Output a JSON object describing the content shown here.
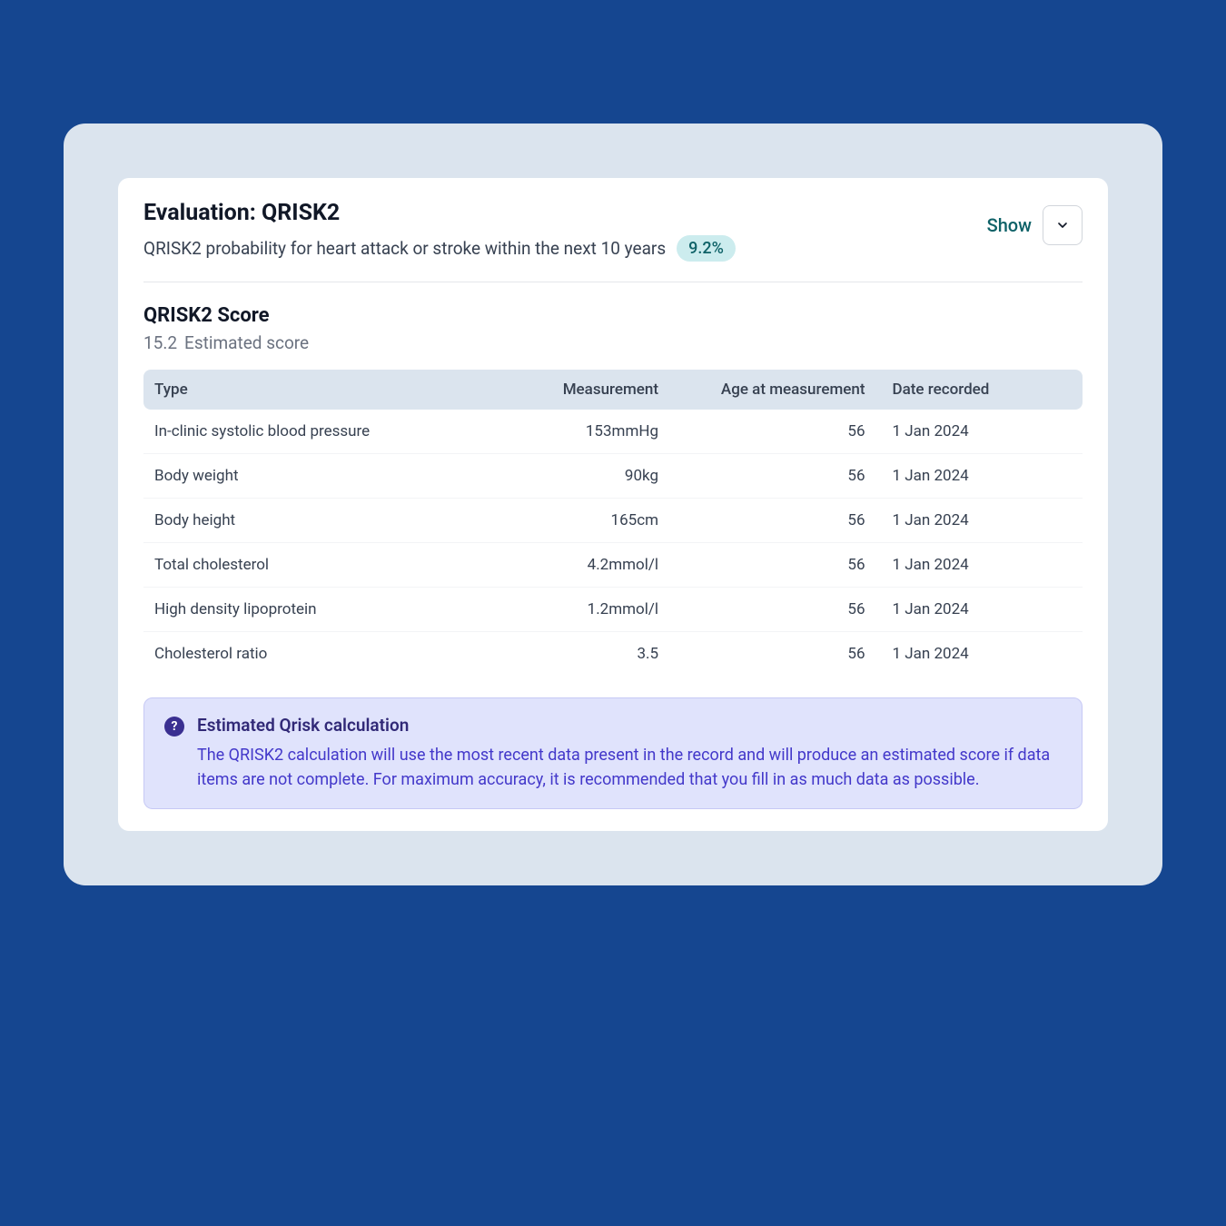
{
  "header": {
    "title": "Evaluation: QRISK2",
    "subtitle": "QRISK2 probability for heart attack or stroke within the next 10 years",
    "probability": "9.2%",
    "show_label": "Show"
  },
  "score": {
    "title": "QRISK2 Score",
    "value": "15.2",
    "label": "Estimated score"
  },
  "table": {
    "headers": {
      "type": "Type",
      "measurement": "Measurement",
      "age": "Age at measurement",
      "date": "Date recorded"
    },
    "rows": [
      {
        "type": "In-clinic systolic blood pressure",
        "measurement": "153mmHg",
        "age": "56",
        "date": "1 Jan 2024"
      },
      {
        "type": "Body weight",
        "measurement": "90kg",
        "age": "56",
        "date": "1 Jan 2024"
      },
      {
        "type": "Body height",
        "measurement": "165cm",
        "age": "56",
        "date": "1 Jan 2024"
      },
      {
        "type": "Total cholesterol",
        "measurement": "4.2mmol/l",
        "age": "56",
        "date": "1 Jan 2024"
      },
      {
        "type": "High density lipoprotein",
        "measurement": "1.2mmol/l",
        "age": "56",
        "date": "1 Jan 2024"
      },
      {
        "type": "Cholesterol ratio",
        "measurement": "3.5",
        "age": "56",
        "date": "1 Jan 2024"
      }
    ]
  },
  "info": {
    "title": "Estimated Qrisk calculation",
    "text": "The QRISK2 calculation will use the most recent data present in the record and will produce an estimated score if data items are not complete. For maximum accuracy, it is recommended that you fill in as much data as possible."
  }
}
